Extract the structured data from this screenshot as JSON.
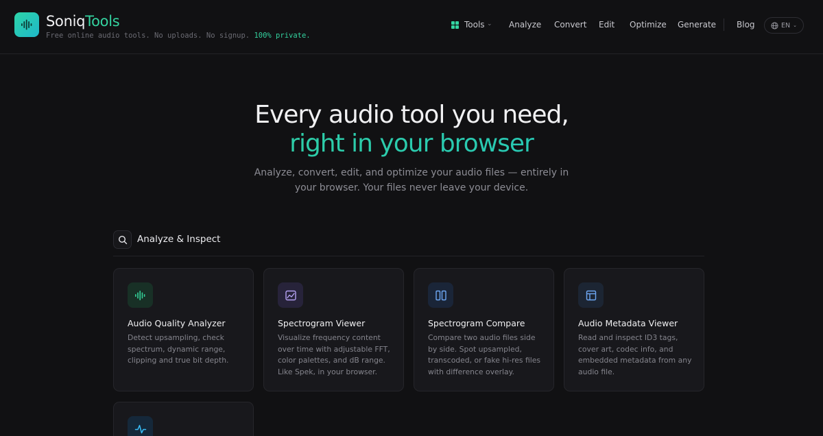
{
  "header": {
    "brand_primary": "Soniq",
    "brand_accent": "Tools",
    "tagline_prefix": "Free online audio tools. No uploads. No signup. ",
    "tagline_highlight": "100% private.",
    "nav": {
      "tools": "Tools",
      "analyze": "Analyze",
      "convert": "Convert",
      "edit": "Edit",
      "optimize": "Optimize",
      "generate": "Generate",
      "blog": "Blog"
    },
    "language": "EN"
  },
  "hero": {
    "title_line1": "Every audio tool you need,",
    "title_line2": "right in your browser",
    "subtitle_line1": "Analyze, convert, edit, and optimize your audio files — entirely in",
    "subtitle_line2": "your browser. Your files never leave your device."
  },
  "section": {
    "title": "Analyze & Inspect"
  },
  "cards": [
    {
      "title": "Audio Quality Analyzer",
      "icon": "waveform-icon",
      "desc": [
        "Detect upsampling, check",
        "spectrum, dynamic range,",
        "clipping and true bit depth."
      ]
    },
    {
      "title": "Spectrogram Viewer",
      "icon": "image-chart-icon",
      "desc": [
        "Visualize frequency content",
        "over time with adjustable FFT,",
        "color palettes, and dB range.",
        "Like Spek, in your browser."
      ]
    },
    {
      "title": "Spectrogram Compare",
      "icon": "columns-icon",
      "desc": [
        "Compare two audio files side",
        "by side. Spot upsampled,",
        "transcoded, or fake hi-res files",
        "with difference overlay."
      ]
    },
    {
      "title": "Audio Metadata Viewer",
      "icon": "layout-icon",
      "desc": [
        "Read and inspect ID3 tags,",
        "cover art, codec info, and",
        "embedded metadata from any",
        "audio file."
      ]
    },
    {
      "title": "",
      "icon": "activity-icon",
      "desc": []
    }
  ],
  "colors": {
    "accent_green": "#34d3a0",
    "accent_teal": "#22c3c2",
    "background": "#111113",
    "card": "#18181c"
  }
}
